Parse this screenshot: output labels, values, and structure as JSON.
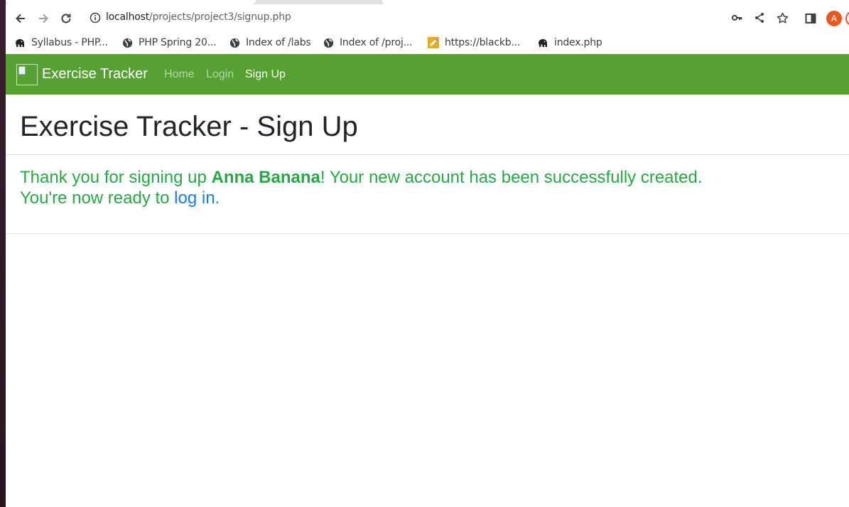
{
  "browser": {
    "url_host": "localhost",
    "url_path": "/projects/project3/signup.php",
    "avatar_letter": "A"
  },
  "bookmarks": [
    {
      "label": "Syllabus - PHP...",
      "icon": "elephant-icon"
    },
    {
      "label": "PHP Spring 20...",
      "icon": "globe-icon"
    },
    {
      "label": "Index of /labs",
      "icon": "globe-icon"
    },
    {
      "label": "Index of /proj...",
      "icon": "globe-icon"
    },
    {
      "label": "https://blackb...",
      "icon": "pencil-icon"
    },
    {
      "label": "index.php",
      "icon": "elephant-icon"
    }
  ],
  "navbar": {
    "brand": "Exercise Tracker",
    "links": [
      "Home",
      "Login",
      "Sign Up"
    ],
    "active": "Sign Up",
    "color": "#57a033"
  },
  "page": {
    "title": "Exercise Tracker - Sign Up",
    "msg_prefix": "Thank you for signing up ",
    "user_name": "Anna Banana",
    "msg_suffix": "! Your new account has been successfully created.",
    "msg_line2_prefix": "You're now ready to ",
    "login_link": "log in",
    "msg_line2_suffix": ".",
    "success_color": "#28a745"
  }
}
